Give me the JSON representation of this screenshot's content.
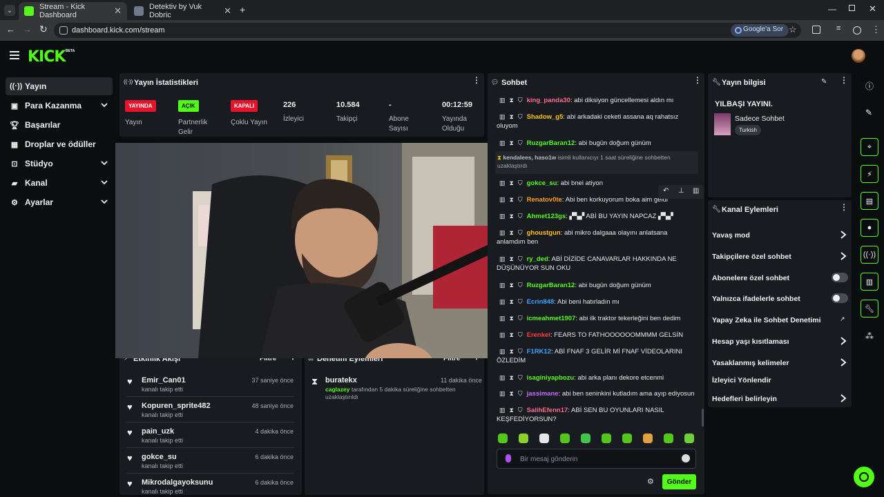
{
  "browser": {
    "tabs": [
      {
        "title": "Stream - Kick Dashboard",
        "active": true
      },
      {
        "title": "Detektiv by Vuk Dobric",
        "active": false
      }
    ],
    "url": "dashboard.kick.com/stream",
    "google_button": "Google'a Sor"
  },
  "brand": {
    "logo": "KICK",
    "beta": "BETA",
    "accent": "#53fc18"
  },
  "sidebar": {
    "items": [
      {
        "label": "Yayın",
        "icon": "stream-icon",
        "active": true,
        "expandable": false
      },
      {
        "label": "Para Kazanma",
        "icon": "money-icon",
        "active": false,
        "expandable": true
      },
      {
        "label": "Başarılar",
        "icon": "trophy-icon",
        "active": false,
        "expandable": false
      },
      {
        "label": "Droplar ve ödüller",
        "icon": "gift-icon",
        "active": false,
        "expandable": false
      },
      {
        "label": "Stüdyo",
        "icon": "studio-icon",
        "active": false,
        "expandable": true
      },
      {
        "label": "Kanal",
        "icon": "channel-icon",
        "active": false,
        "expandable": true
      },
      {
        "label": "Ayarlar",
        "icon": "gear-icon",
        "active": false,
        "expandable": true
      }
    ]
  },
  "stats": {
    "title": "Yayın İstatistikleri",
    "items": [
      {
        "badge": "YAYINDA",
        "label": "Yayın",
        "badge_color": "#e8132b"
      },
      {
        "badge": "AÇIK",
        "label": "Partnerlik Gelir",
        "badge_color": "#53fc18"
      },
      {
        "badge": "KAPALI",
        "label": "Çoklu Yayın",
        "badge_color": "#e8132b"
      },
      {
        "value": "226",
        "label": "İzleyici"
      },
      {
        "value": "10.584",
        "label": "Takipçi"
      },
      {
        "value": "-",
        "label": "Abone Sayısı"
      },
      {
        "value": "00:12:59",
        "label": "Yayında Olduğu"
      }
    ]
  },
  "activity": {
    "title": "Etkinlik Akışı",
    "filter": "Filtre",
    "items": [
      {
        "name": "Emir_Can01",
        "sub": "kanalı takip etti",
        "time": "37 saniye önce"
      },
      {
        "name": "Kopuren_sprite482",
        "sub": "kanalı takip etti",
        "time": "48 saniye önce"
      },
      {
        "name": "pain_uzk",
        "sub": "kanalı takip etti",
        "time": "4 dakika önce"
      },
      {
        "name": "gokce_su",
        "sub": "kanalı takip etti",
        "time": "6 dakika önce"
      },
      {
        "name": "Mikrodalgayoksunu",
        "sub": "kanalı takip etti",
        "time": "6 dakika önce"
      }
    ]
  },
  "moderation": {
    "title": "Denetim Eylemleri",
    "filter": "Filtre",
    "items": [
      {
        "name": "buratekx",
        "time": "11 dakika önce",
        "actor": "caglazey",
        "text": "tarafından 5 dakika süreliğine sohbetten uzaklaştırıldı"
      }
    ]
  },
  "chat": {
    "title": "Sohbet",
    "messages": [
      {
        "user": "king_panda30",
        "color": "#ff6b8a",
        "text": ": abi diksiyon güncellemesi aldın mı"
      },
      {
        "user": "Shadow_g5",
        "color": "#ffc21a",
        "text": ": abi arkadaki ceketi assana aq rahatsız oluyom"
      },
      {
        "user": "RuzgarBaran12",
        "color": "#53fc18",
        "text": ": abi bugün doğum günüm"
      },
      {
        "user": "gokce_su",
        "color": "#53fc18",
        "text": ": abi bnei atiyon"
      },
      {
        "user": "Renatov0te",
        "color": "#ff9f1a",
        "text": ": Abi ben korkuyorum boka aim geldi"
      },
      {
        "user": "Ahmet123gs",
        "color": "#53fc18",
        "text": ": ▞▚▞ ABİ BU YAYIN NAPCAZ ▞▚▞"
      },
      {
        "user": "ghoustgun",
        "color": "#ffc21a",
        "text": ": abi mikro dalgaaa olayını anlatsana anlamdım ben"
      },
      {
        "user": "ry_ded",
        "color": "#53fc18",
        "text": ": ABİ DİZİDE CANAVARLAR HAKKINDA NE DÜŞÜNÜYOR SUN OKU"
      },
      {
        "user": "RuzgarBaran12",
        "color": "#53fc18",
        "text": ": abi bugün doğum günüm"
      },
      {
        "user": "Ecrin848",
        "color": "#3fa3ff",
        "text": ": Abi beni hatırladın mı"
      },
      {
        "user": "icmeahmet1907",
        "color": "#53fc18",
        "text": ": abi ilk traktor tekerleğini ben dedim"
      },
      {
        "user": "Erenkei",
        "color": "#ff3b3b",
        "text": ": FEARS TO FATHOOOOOOMMMM GELSİN"
      },
      {
        "user": "F1RK12",
        "color": "#3fa3ff",
        "text": ": ABİ FNAF 3 GELİR Mİ FNAF VİDEOLARINI ÖZLEDİM"
      },
      {
        "user": "isaginiyapbozu",
        "color": "#53fc18",
        "text": ": abi arka planı dekore etcenmi"
      },
      {
        "user": "jassimane",
        "color": "#c86bff",
        "text": ": abi ben seninkini kutladım ama ayıp ediyosun"
      },
      {
        "user": "SalihEfenn17",
        "color": "#ff6b8a",
        "text": ": ABİ SEN BU OYUNLARI NASIL KEŞFEDİYORSUN?"
      }
    ],
    "system": {
      "users": "kendalees, haso1w",
      "text": "isimli kullanıcıyı 1 saat süreliğine sohbetten uzaklaştırdı"
    },
    "placeholder": "Bir mesaj gönderin",
    "send": "Gönder"
  },
  "stream_info": {
    "title": "Yayın bilgisi",
    "stream_title": "YILBAŞI YAYINI.",
    "category": "Sadece Sohbet",
    "language": "Turkish"
  },
  "channel_actions": {
    "title": "Kanal Eylemleri",
    "items": [
      {
        "label": "Yavaş mod",
        "control": "chevron"
      },
      {
        "label": "Takipçilere özel sohbet",
        "control": "chevron"
      },
      {
        "label": "Abonelere özel sohbet",
        "control": "toggle"
      },
      {
        "label": "Yalnızca ifadelerle sohbet",
        "control": "toggle"
      },
      {
        "label": "Yapay Zeka ile Sohbet Denetimi",
        "control": "external"
      },
      {
        "label": "Hesap yaşı kısıtlaması",
        "control": "chevron"
      },
      {
        "label": "Yasaklanmış kelimeler",
        "control": "chevron"
      },
      {
        "label": "İzleyici Yönlendir",
        "control": "none"
      },
      {
        "label": "Hedefleri belirleyin",
        "control": "chevron"
      }
    ]
  }
}
